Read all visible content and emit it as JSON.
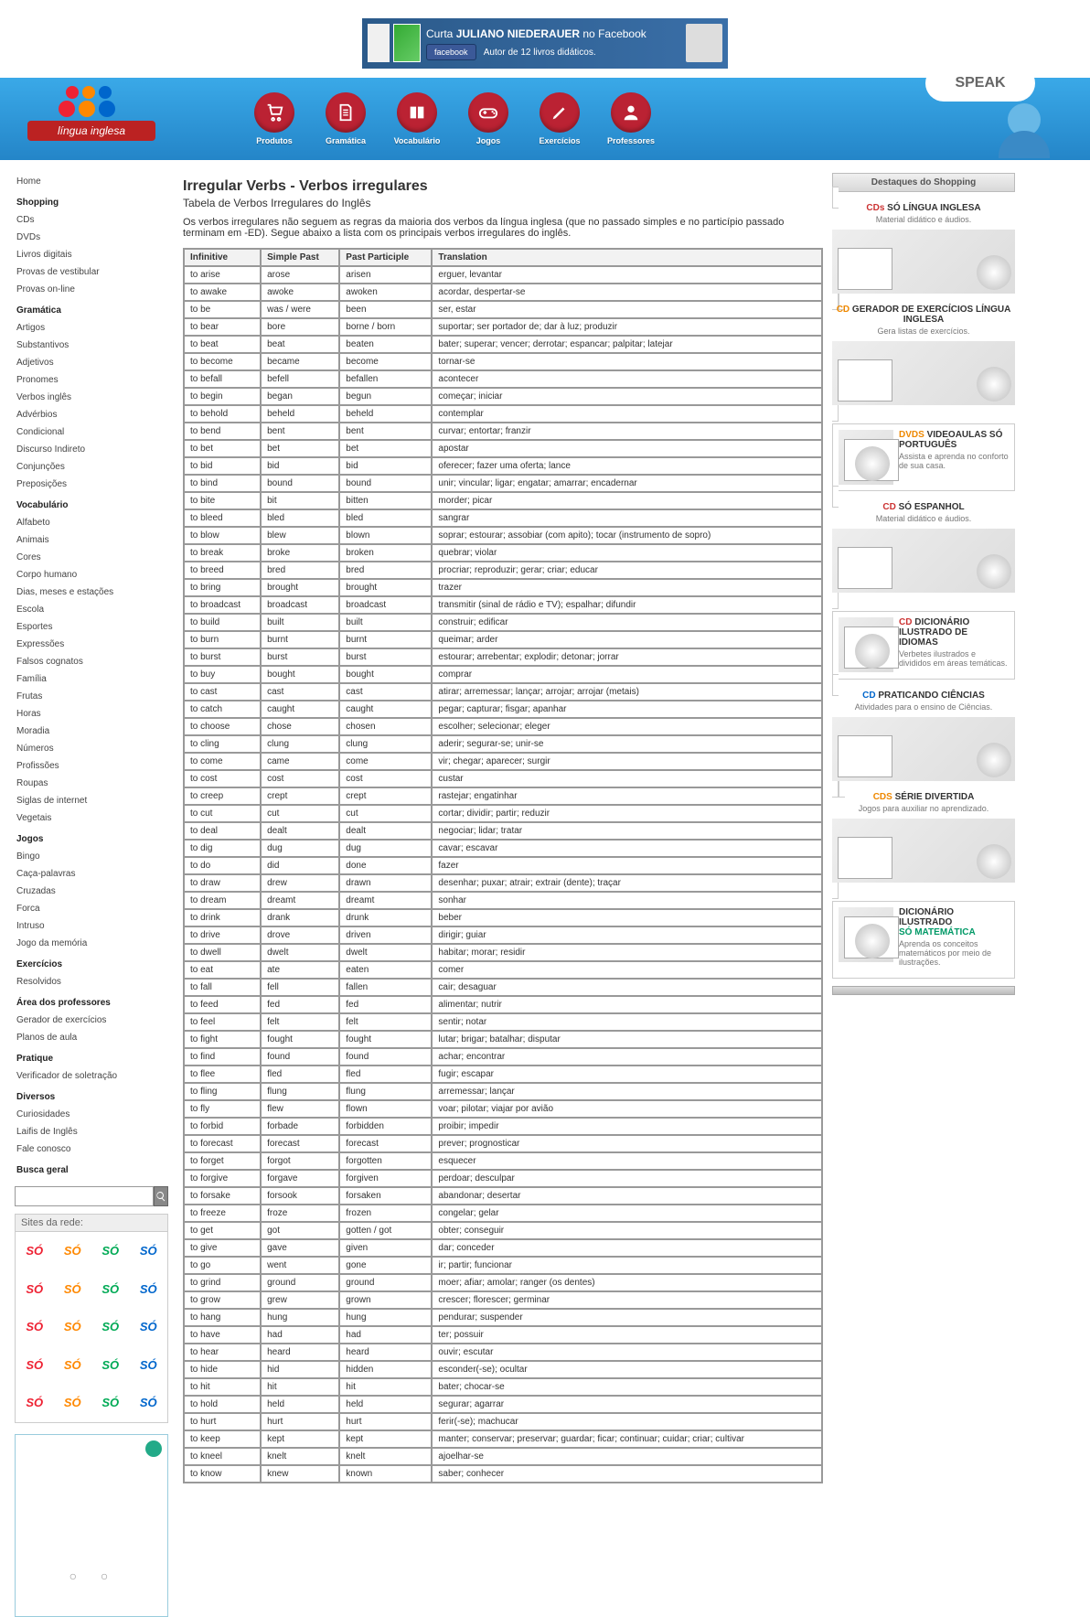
{
  "topbanner": {
    "line1_pre": "Curta ",
    "line1_b": "JULIANO NIEDERAUER",
    "line1_post": " no Facebook",
    "btn": "facebook",
    "line2": "Autor de 12 livros didáticos."
  },
  "logo_text": "língua inglesa",
  "speak_text": "SPEAK",
  "nav": [
    {
      "label": "Produtos",
      "icon": "cart"
    },
    {
      "label": "Gramática",
      "icon": "doc"
    },
    {
      "label": "Vocabulário",
      "icon": "book"
    },
    {
      "label": "Jogos",
      "icon": "pad"
    },
    {
      "label": "Exercícios",
      "icon": "pen"
    },
    {
      "label": "Professores",
      "icon": "user"
    }
  ],
  "leftmenu": [
    {
      "t": "Home",
      "g": 0
    },
    {
      "t": "Shopping",
      "g": 1
    },
    {
      "t": "CDs",
      "g": 0
    },
    {
      "t": "DVDs",
      "g": 0
    },
    {
      "t": "Livros digitais",
      "g": 0
    },
    {
      "t": "Provas de vestibular",
      "g": 0
    },
    {
      "t": "Provas on-line",
      "g": 0
    },
    {
      "t": "Gramática",
      "g": 1
    },
    {
      "t": "Artigos",
      "g": 0
    },
    {
      "t": "Substantivos",
      "g": 0
    },
    {
      "t": "Adjetivos",
      "g": 0
    },
    {
      "t": "Pronomes",
      "g": 0
    },
    {
      "t": "Verbos inglês",
      "g": 0
    },
    {
      "t": "Advérbios",
      "g": 0
    },
    {
      "t": "Condicional",
      "g": 0
    },
    {
      "t": "Discurso Indireto",
      "g": 0
    },
    {
      "t": "Conjunções",
      "g": 0
    },
    {
      "t": "Preposições",
      "g": 0
    },
    {
      "t": "Vocabulário",
      "g": 1
    },
    {
      "t": "Alfabeto",
      "g": 0
    },
    {
      "t": "Animais",
      "g": 0
    },
    {
      "t": "Cores",
      "g": 0
    },
    {
      "t": "Corpo humano",
      "g": 0
    },
    {
      "t": "Dias, meses e estações",
      "g": 0
    },
    {
      "t": "Escola",
      "g": 0
    },
    {
      "t": "Esportes",
      "g": 0
    },
    {
      "t": "Expressões",
      "g": 0
    },
    {
      "t": "Falsos cognatos",
      "g": 0
    },
    {
      "t": "Família",
      "g": 0
    },
    {
      "t": "Frutas",
      "g": 0
    },
    {
      "t": "Horas",
      "g": 0
    },
    {
      "t": "Moradia",
      "g": 0
    },
    {
      "t": "Números",
      "g": 0
    },
    {
      "t": "Profissões",
      "g": 0
    },
    {
      "t": "Roupas",
      "g": 0
    },
    {
      "t": "Siglas de internet",
      "g": 0
    },
    {
      "t": "Vegetais",
      "g": 0
    },
    {
      "t": "Jogos",
      "g": 1
    },
    {
      "t": "Bingo",
      "g": 0
    },
    {
      "t": "Caça-palavras",
      "g": 0
    },
    {
      "t": "Cruzadas",
      "g": 0
    },
    {
      "t": "Forca",
      "g": 0
    },
    {
      "t": "Intruso",
      "g": 0
    },
    {
      "t": "Jogo da memória",
      "g": 0
    },
    {
      "t": "Exercícios",
      "g": 1
    },
    {
      "t": "Resolvidos",
      "g": 0
    },
    {
      "t": "Área dos professores",
      "g": 1
    },
    {
      "t": "Gerador de exercícios",
      "g": 0
    },
    {
      "t": "Planos de aula",
      "g": 0
    },
    {
      "t": "Pratique",
      "g": 1
    },
    {
      "t": "Verificador de soletração",
      "g": 0
    },
    {
      "t": "Diversos",
      "g": 1
    },
    {
      "t": "Curiosidades",
      "g": 0
    },
    {
      "t": "Laifis de Inglês",
      "g": 0
    },
    {
      "t": "Fale conosco",
      "g": 0
    },
    {
      "t": "Busca geral",
      "g": 1
    }
  ],
  "sites_hdr": "Sites da rede:",
  "page": {
    "title": "Irregular Verbs - Verbos irregulares",
    "subtitle": "Tabela de Verbos Irregulares do Inglês",
    "intro": "Os verbos irregulares não seguem as regras da maioria dos verbos da língua inglesa (que no passado simples e no particípio passado terminam em -ED). Segue abaixo a lista com os principais verbos irregulares do inglês."
  },
  "th": [
    "Infinitive",
    "Simple Past",
    "Past Participle",
    "Translation"
  ],
  "verbs": [
    [
      "to arise",
      "arose",
      "arisen",
      "erguer, levantar"
    ],
    [
      "to awake",
      "awoke",
      "awoken",
      "acordar, despertar-se"
    ],
    [
      "to be",
      "was / were",
      "been",
      "ser, estar"
    ],
    [
      "to bear",
      "bore",
      "borne / born",
      "suportar; ser portador de; dar à luz; produzir"
    ],
    [
      "to beat",
      "beat",
      "beaten",
      "bater; superar; vencer; derrotar; espancar; palpitar; latejar"
    ],
    [
      "to become",
      "became",
      "become",
      "tornar-se"
    ],
    [
      "to befall",
      "befell",
      "befallen",
      "acontecer"
    ],
    [
      "to begin",
      "began",
      "begun",
      "começar; iniciar"
    ],
    [
      "to behold",
      "beheld",
      "beheld",
      "contemplar"
    ],
    [
      "to bend",
      "bent",
      "bent",
      "curvar; entortar; franzir"
    ],
    [
      "to bet",
      "bet",
      "bet",
      "apostar"
    ],
    [
      "to bid",
      "bid",
      "bid",
      "oferecer; fazer uma oferta; lance"
    ],
    [
      "to bind",
      "bound",
      "bound",
      "unir; vincular; ligar; engatar; amarrar; encadernar"
    ],
    [
      "to bite",
      "bit",
      "bitten",
      "morder; picar"
    ],
    [
      "to bleed",
      "bled",
      "bled",
      "sangrar"
    ],
    [
      "to blow",
      "blew",
      "blown",
      "soprar; estourar; assobiar (com apito); tocar (instrumento de sopro)"
    ],
    [
      "to break",
      "broke",
      "broken",
      "quebrar; violar"
    ],
    [
      "to breed",
      "bred",
      "bred",
      "procriar; reproduzir; gerar; criar; educar"
    ],
    [
      "to bring",
      "brought",
      "brought",
      "trazer"
    ],
    [
      "to broadcast",
      "broadcast",
      "broadcast",
      "transmitir (sinal de rádio e TV); espalhar; difundir"
    ],
    [
      "to build",
      "built",
      "built",
      "construir; edificar"
    ],
    [
      "to burn",
      "burnt",
      "burnt",
      "queimar; arder"
    ],
    [
      "to burst",
      "burst",
      "burst",
      "estourar; arrebentar; explodir; detonar; jorrar"
    ],
    [
      "to buy",
      "bought",
      "bought",
      "comprar"
    ],
    [
      "to cast",
      "cast",
      "cast",
      "atirar; arremessar; lançar; arrojar; arrojar (metais)"
    ],
    [
      "to catch",
      "caught",
      "caught",
      "pegar; capturar; fisgar; apanhar"
    ],
    [
      "to choose",
      "chose",
      "chosen",
      "escolher; selecionar; eleger"
    ],
    [
      "to cling",
      "clung",
      "clung",
      "aderir; segurar-se; unir-se"
    ],
    [
      "to come",
      "came",
      "come",
      "vir; chegar; aparecer; surgir"
    ],
    [
      "to cost",
      "cost",
      "cost",
      "custar"
    ],
    [
      "to creep",
      "crept",
      "crept",
      "rastejar; engatinhar"
    ],
    [
      "to cut",
      "cut",
      "cut",
      "cortar; dividir; partir; reduzir"
    ],
    [
      "to deal",
      "dealt",
      "dealt",
      "negociar; lidar; tratar"
    ],
    [
      "to dig",
      "dug",
      "dug",
      "cavar; escavar"
    ],
    [
      "to do",
      "did",
      "done",
      "fazer"
    ],
    [
      "to draw",
      "drew",
      "drawn",
      "desenhar; puxar; atrair; extrair (dente); traçar"
    ],
    [
      "to dream",
      "dreamt",
      "dreamt",
      "sonhar"
    ],
    [
      "to drink",
      "drank",
      "drunk",
      "beber"
    ],
    [
      "to drive",
      "drove",
      "driven",
      "dirigir; guiar"
    ],
    [
      "to dwell",
      "dwelt",
      "dwelt",
      "habitar; morar; residir"
    ],
    [
      "to eat",
      "ate",
      "eaten",
      "comer"
    ],
    [
      "to fall",
      "fell",
      "fallen",
      "cair; desaguar"
    ],
    [
      "to feed",
      "fed",
      "fed",
      "alimentar; nutrir"
    ],
    [
      "to feel",
      "felt",
      "felt",
      "sentir; notar"
    ],
    [
      "to fight",
      "fought",
      "fought",
      "lutar; brigar; batalhar; disputar"
    ],
    [
      "to find",
      "found",
      "found",
      "achar; encontrar"
    ],
    [
      "to flee",
      "fled",
      "fled",
      "fugir; escapar"
    ],
    [
      "to fling",
      "flung",
      "flung",
      "arremessar; lançar"
    ],
    [
      "to fly",
      "flew",
      "flown",
      "voar; pilotar; viajar por avião"
    ],
    [
      "to forbid",
      "forbade",
      "forbidden",
      "proibir; impedir"
    ],
    [
      "to forecast",
      "forecast",
      "forecast",
      "prever; prognosticar"
    ],
    [
      "to forget",
      "forgot",
      "forgotten",
      "esquecer"
    ],
    [
      "to forgive",
      "forgave",
      "forgiven",
      "perdoar; desculpar"
    ],
    [
      "to forsake",
      "forsook",
      "forsaken",
      "abandonar; desertar"
    ],
    [
      "to freeze",
      "froze",
      "frozen",
      "congelar; gelar"
    ],
    [
      "to get",
      "got",
      "gotten / got",
      "obter; conseguir"
    ],
    [
      "to give",
      "gave",
      "given",
      "dar; conceder"
    ],
    [
      "to go",
      "went",
      "gone",
      "ir; partir; funcionar"
    ],
    [
      "to grind",
      "ground",
      "ground",
      "moer; afiar; amolar; ranger (os dentes)"
    ],
    [
      "to grow",
      "grew",
      "grown",
      "crescer; florescer; germinar"
    ],
    [
      "to hang",
      "hung",
      "hung",
      "pendurar; suspender"
    ],
    [
      "to have",
      "had",
      "had",
      "ter; possuir"
    ],
    [
      "to hear",
      "heard",
      "heard",
      "ouvir; escutar"
    ],
    [
      "to hide",
      "hid",
      "hidden",
      "esconder(-se); ocultar"
    ],
    [
      "to hit",
      "hit",
      "hit",
      "bater; chocar-se"
    ],
    [
      "to hold",
      "held",
      "held",
      "segurar; agarrar"
    ],
    [
      "to hurt",
      "hurt",
      "hurt",
      "ferir(-se); machucar"
    ],
    [
      "to keep",
      "kept",
      "kept",
      "manter; conservar; preservar; guardar; ficar; continuar; cuidar; criar; cultivar"
    ],
    [
      "to kneel",
      "knelt",
      "knelt",
      "ajoelhar-se"
    ],
    [
      "to know",
      "knew",
      "known",
      "saber; conhecer"
    ]
  ],
  "shop_hd": "Destaques do Shopping",
  "cards": [
    {
      "type": "v",
      "t1a": "CDs",
      "c1": "r",
      "t1b": " SÓ LÍNGUA INGLESA",
      "t2": "Material didático e áudios."
    },
    {
      "type": "v",
      "t1a": "CD",
      "c1": "o",
      "t1b": " GERADOR DE EXERCÍCIOS LÍNGUA INGLESA",
      "t2": "Gera listas de exercícios."
    },
    {
      "type": "h",
      "t1a": "DVDS",
      "c1": "o",
      "t1b": " VIDEOAULAS SÓ PORTUGUÊS",
      "t2": "Assista e aprenda no conforto de sua casa."
    },
    {
      "type": "v",
      "t1a": "CD",
      "c1": "r",
      "t1b": " SÓ ESPANHOL",
      "t2": "Material didático e áudios."
    },
    {
      "type": "h",
      "t1a": "CD",
      "c1": "r",
      "t1b": " DICIONÁRIO ILUSTRADO DE IDIOMAS",
      "t2": "Verbetes ilustrados e divididos em áreas temáticas."
    },
    {
      "type": "v",
      "t1a": "CD",
      "c1": "b",
      "t1b": " PRATICANDO CIÊNCIAS",
      "t2": "Atividades para o ensino de Ciências."
    },
    {
      "type": "v",
      "t1a": "CDS",
      "c1": "o",
      "t1b": " SÉRIE DIVERTIDA",
      "t2": "Jogos para auxiliar no aprendizado."
    },
    {
      "type": "h",
      "t1a": "DICIONÁRIO ILUSTRADO",
      "c1": "",
      "t1b": "\nSÓ MATEMÁTICA",
      "c2": "g",
      "t2": "Aprenda os conceitos matemáticos por meio de ilustrações."
    }
  ]
}
